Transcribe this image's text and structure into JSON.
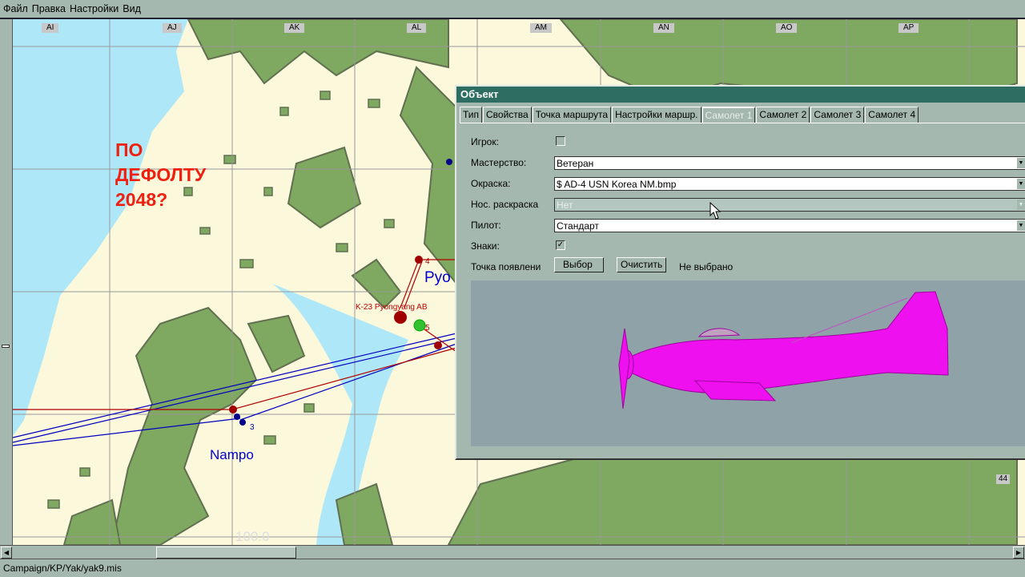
{
  "menu": [
    "Файл",
    "Правка",
    "Настройки",
    "Вид"
  ],
  "grid_columns": [
    "AI",
    "AJ",
    "AK",
    "AL",
    "AM",
    "AN",
    "AO",
    "AP"
  ],
  "grid_row_label": "44",
  "map": {
    "annotation": [
      "ПО",
      "ДЕФОЛТУ",
      "2048?"
    ],
    "cities": [
      "Pyo",
      "Nampo"
    ],
    "airfield": "K-23 Pyongyang AB",
    "waypoints": [
      "4",
      "5",
      "3"
    ],
    "bottom_value": "100.0"
  },
  "dialog": {
    "title": "Объект",
    "tabs": [
      "Тип",
      "Свойства",
      "Точка маршрута",
      "Настройки маршр.",
      "Самолет 1",
      "Самолет 2",
      "Самолет 3",
      "Самолет 4"
    ],
    "fields": {
      "player_label": "Игрок:",
      "player_checked": false,
      "skill_label": "Мастерство:",
      "skill_value": "Ветеран",
      "skin_label": "Окраска:",
      "skin_value": "$ AD-4 USN Korea NM.bmp",
      "nose_label": "Нос. раскраска",
      "nose_value": "Нет",
      "pilot_label": "Пилот:",
      "pilot_value": "Стандарт",
      "markings_label": "Знаки:",
      "markings_checked": true,
      "spawn_label": "Точка появлени",
      "select_button": "Выбор",
      "clear_button": "Очистить",
      "spawn_value": "Не выбрано"
    }
  },
  "status": "Campaign/KP/Yak/yak9.mis",
  "colors": {
    "title_bar": "#2e6e62",
    "sea": "#aee8f8",
    "land": "#fbf8dc",
    "forest": "#7fa860",
    "route_blue": "#0000c0",
    "route_red": "#b00000",
    "plane": "#ff00ff"
  }
}
